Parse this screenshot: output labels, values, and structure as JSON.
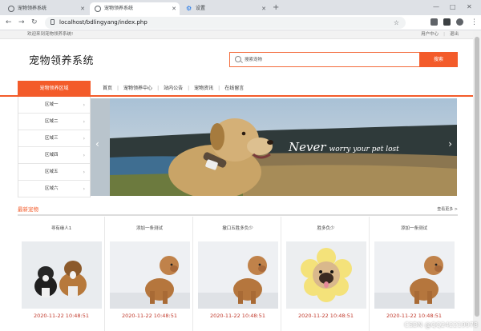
{
  "browser": {
    "tabs": [
      {
        "label": "宠物领养系统",
        "active": false
      },
      {
        "label": "宠物领养系统",
        "active": true
      },
      {
        "label": "设置",
        "active": false
      }
    ],
    "url": "localhost/bdlingyang/index.php"
  },
  "site": {
    "welcome": "欢迎来到宠物领养系统!",
    "user_center": "用户中心",
    "logout": "退出",
    "logo": "宠物领养系统",
    "search_placeholder": "搜索宠物",
    "search_button": "搜索",
    "category_button": "宠物领养区域",
    "nav": [
      "首页",
      "宠物领养中心",
      "站内公告",
      "宠物资讯",
      "在线留言"
    ],
    "regions": [
      "区域一",
      "区域二",
      "区域三",
      "区域四",
      "区域五",
      "区域六"
    ],
    "banner": {
      "big": "Never",
      "small": "worry your pet lost"
    },
    "section_title": "最新宠物",
    "more": "查看更多 >"
  },
  "cards": [
    {
      "title": "寻有缘人1",
      "date": "2020-11-22 10:48:51",
      "image": "two-dogs"
    },
    {
      "title": "添加一条测试",
      "date": "2020-11-22 10:48:51",
      "image": "poodle"
    },
    {
      "title": "撤口五胜多负少",
      "date": "2020-11-22 10:48:51",
      "image": "poodle"
    },
    {
      "title": "胜多负少",
      "date": "2020-11-22 10:48:51",
      "image": "pug-flower"
    },
    {
      "title": "添加一条测试",
      "date": "2020-11-22 10:48:51",
      "image": "poodle"
    }
  ],
  "watermark": "CSDN @QQ242219978",
  "colors": {
    "accent": "#f35b2a",
    "date": "#c0392b"
  }
}
